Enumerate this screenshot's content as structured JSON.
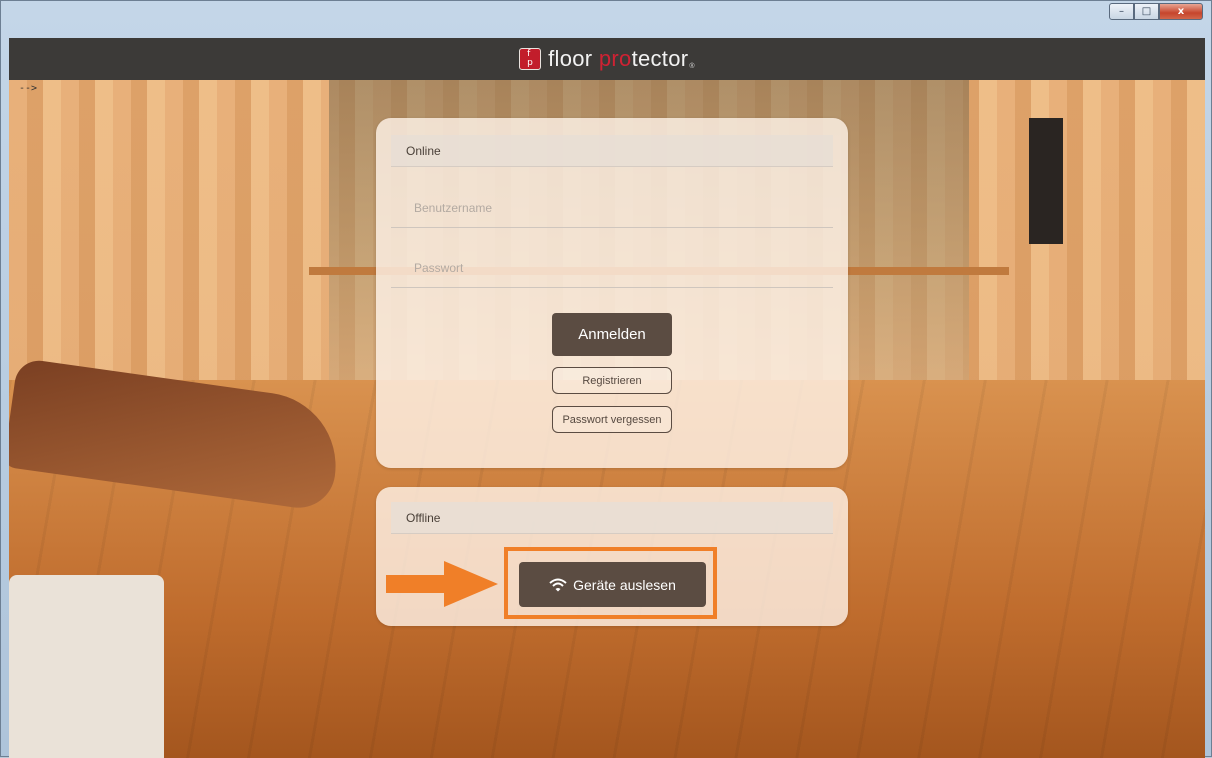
{
  "window": {
    "controls": {
      "minimize": "–",
      "maximize": "□",
      "close": "x"
    }
  },
  "header": {
    "logo_icon_letters": "f p",
    "logo_part1": "floor ",
    "logo_accent": "pro",
    "logo_part2": "tector",
    "logo_reg": "®"
  },
  "stray_text": "-->",
  "online": {
    "title": "Online",
    "username_placeholder": "Benutzername",
    "password_placeholder": "Passwort",
    "login_label": "Anmelden",
    "register_label": "Registrieren",
    "forgot_label": "Passwort vergessen"
  },
  "offline": {
    "title": "Offline",
    "read_devices_label": "Geräte auslesen",
    "read_devices_icon": "wifi-icon"
  },
  "colors": {
    "header_bg": "#3c3a38",
    "brand_red": "#cf2233",
    "button_brown": "#5b4c42",
    "highlight_orange": "#f07f28"
  }
}
